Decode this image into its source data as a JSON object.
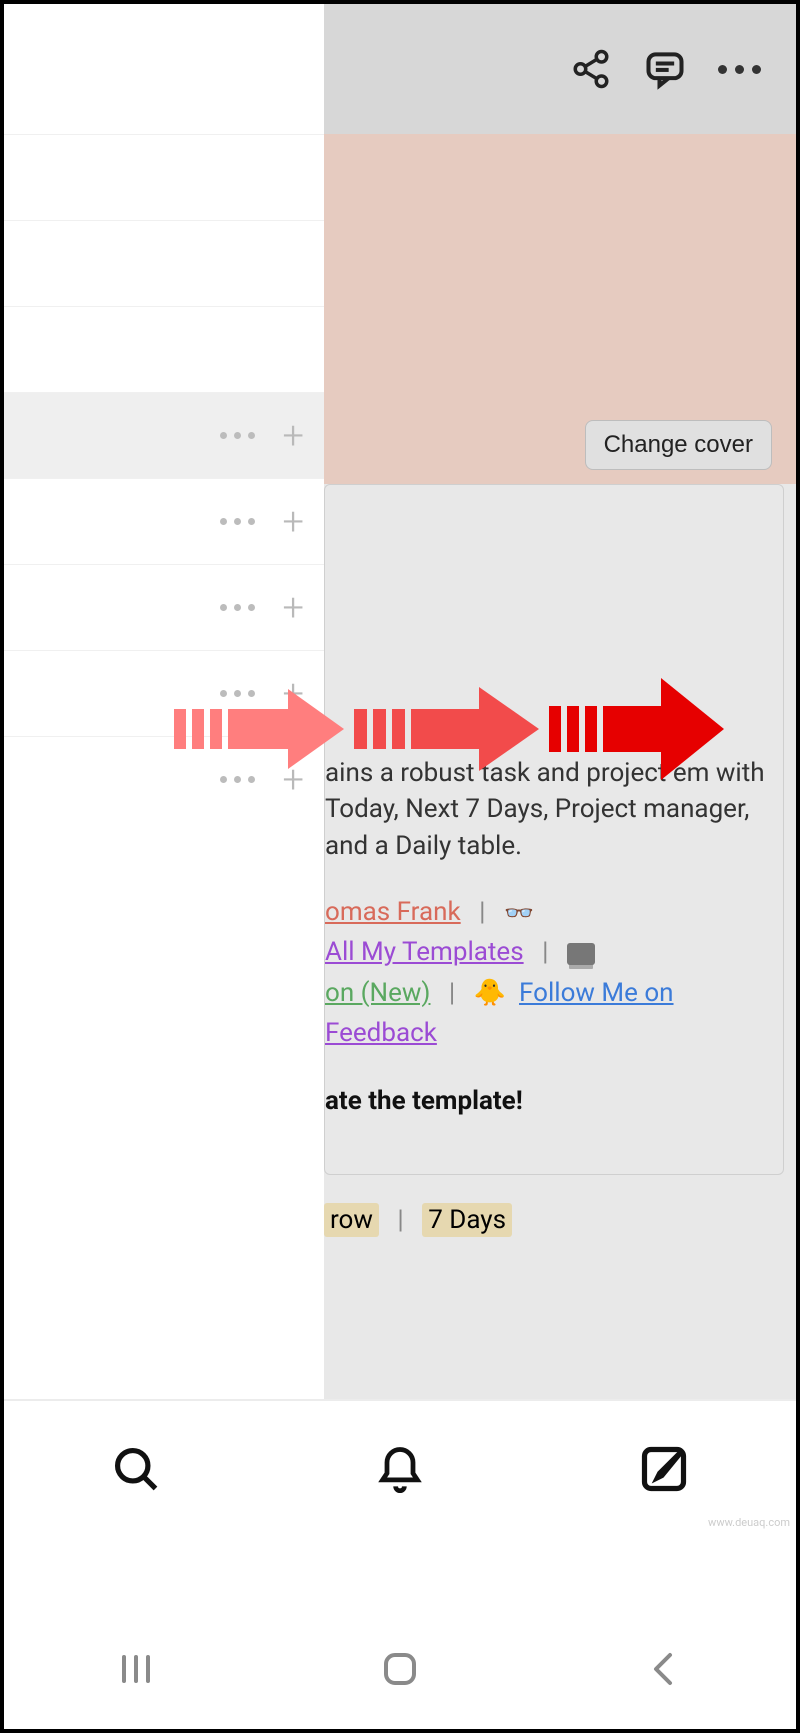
{
  "topbar": {
    "share_icon": "share-icon",
    "comment_icon": "comment-icon",
    "more_icon": "more-icon"
  },
  "cover": {
    "change_cover_label": "Change cover"
  },
  "callout": {
    "description": "ains a robust task and project em with Today, Next 7 Days, Project manager, and a Daily table.",
    "author_label": "omas Frank",
    "templates_label": "All My Templates",
    "new_label": "on (New)",
    "follow_label": "Follow Me on",
    "feedback_label": "Feedback",
    "cta_label": "ate the template!"
  },
  "filters": {
    "tomorrow": "row",
    "seven_days": "7 Days"
  },
  "sidebar": {
    "rows": [
      {
        "selected": false,
        "has_actions": false
      },
      {
        "selected": false,
        "has_actions": false
      },
      {
        "selected": false,
        "has_actions": false
      },
      {
        "selected": true,
        "has_actions": true
      },
      {
        "selected": false,
        "has_actions": true
      },
      {
        "selected": false,
        "has_actions": true
      },
      {
        "selected": false,
        "has_actions": true
      },
      {
        "selected": false,
        "has_actions": true
      }
    ]
  },
  "appbar": {
    "search": "search-icon",
    "notifications": "bell-icon",
    "compose": "compose-icon"
  },
  "sysnav": {
    "recents": "recents-icon",
    "home": "home-icon",
    "back": "back-icon"
  },
  "watermark": "www.deuaq.com"
}
